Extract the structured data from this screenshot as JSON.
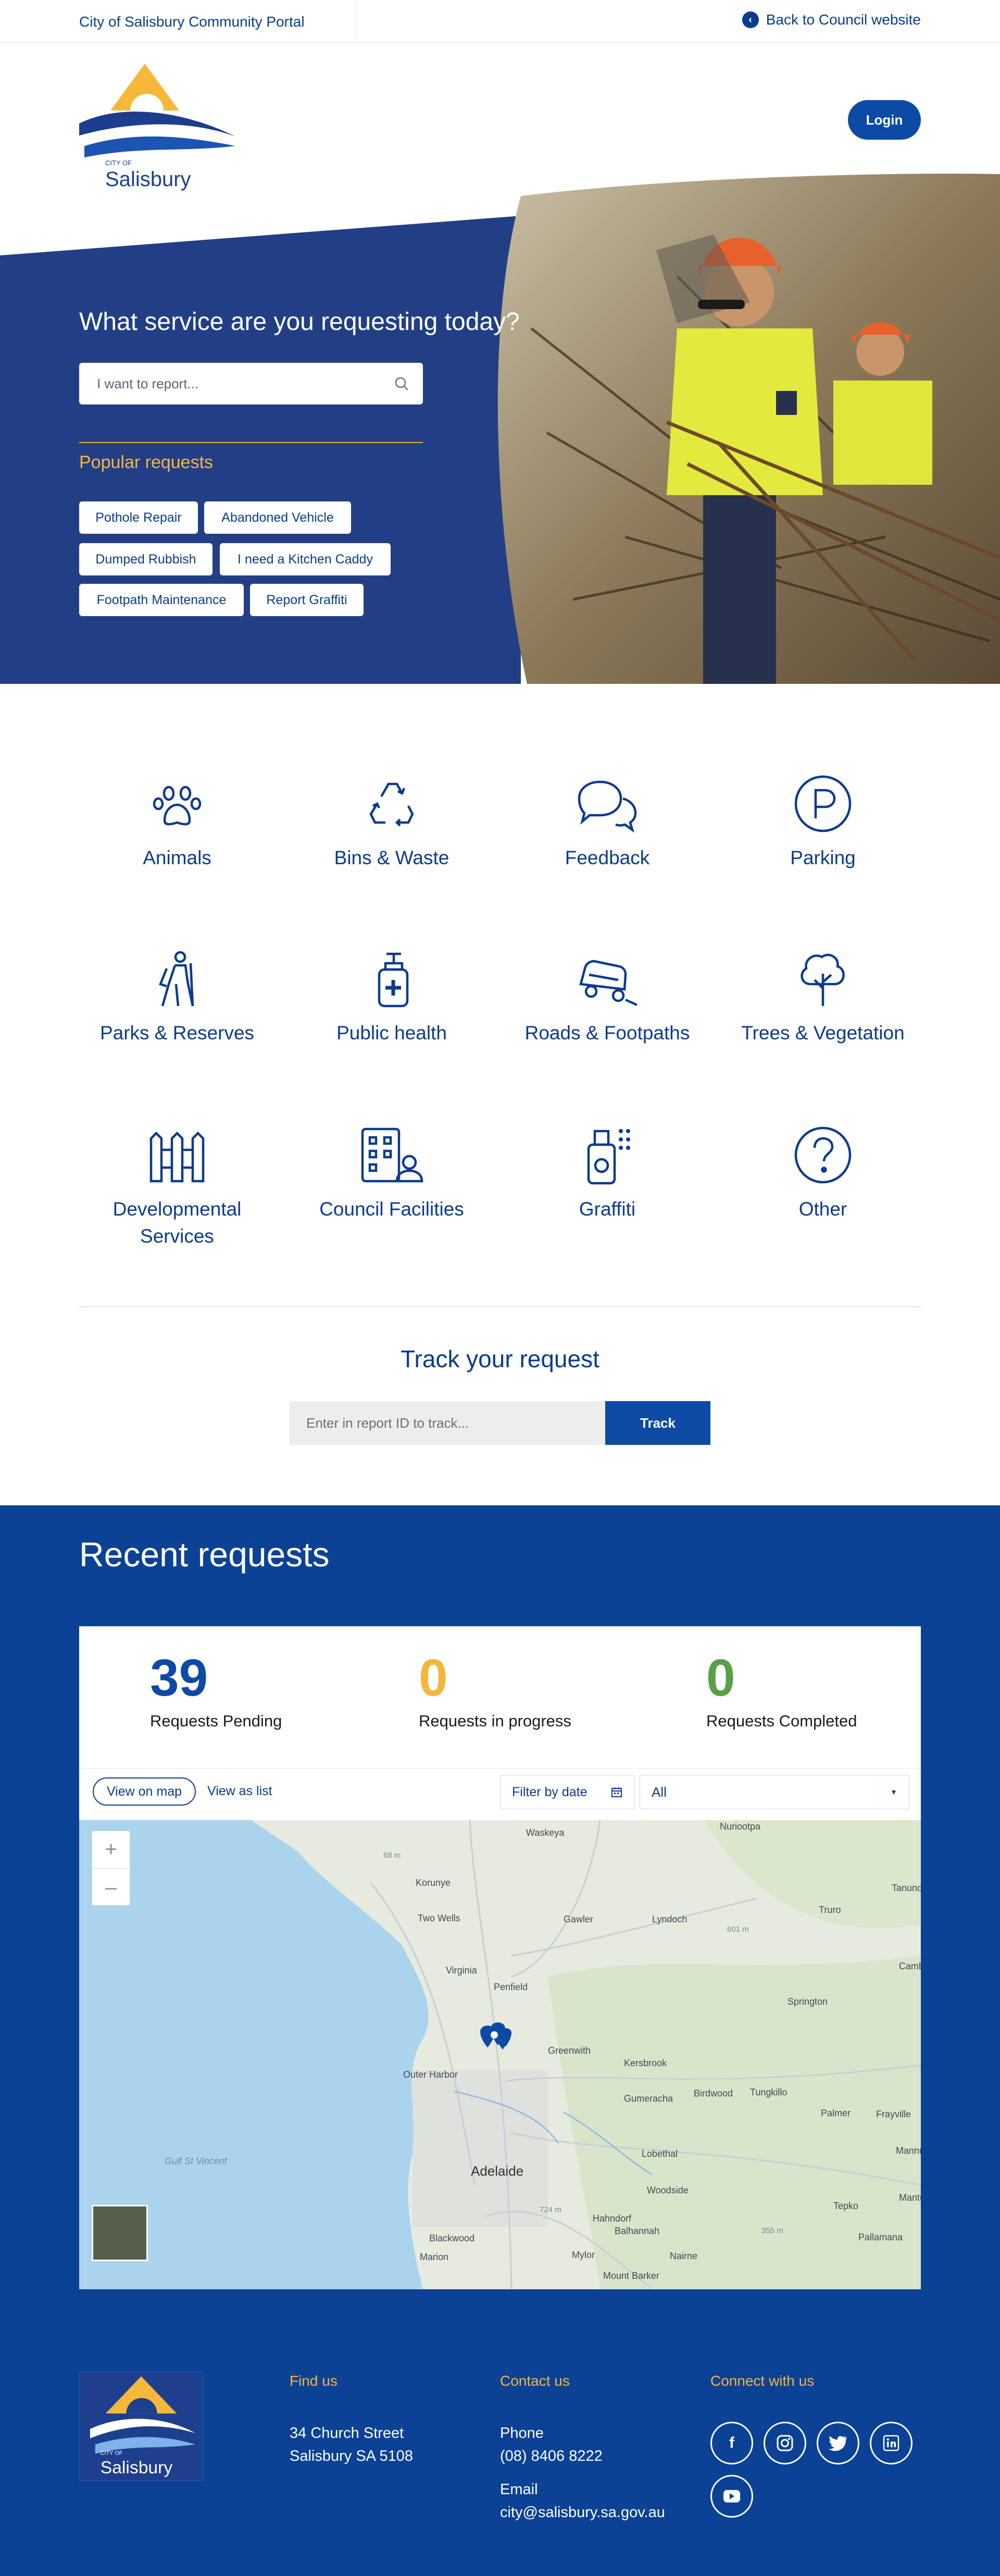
{
  "topbar": {
    "portal": "City of Salisbury Community Portal",
    "back": "Back to Council website"
  },
  "brand": {
    "city_of": "CITY OF",
    "name": "Salisbury"
  },
  "header": {
    "login": "Login"
  },
  "hero": {
    "title": "What service are you requesting today?",
    "search_placeholder": "I want to report...",
    "popular_title": "Popular requests",
    "popular": [
      "Pothole Repair",
      "Abandoned Vehicle",
      "Dumped Rubbish",
      "I need a Kitchen Caddy",
      "Footpath Maintenance",
      "Report Graffiti"
    ]
  },
  "categories": [
    {
      "label": "Animals",
      "icon": "paw-icon"
    },
    {
      "label": "Bins & Waste",
      "icon": "recycle-icon"
    },
    {
      "label": "Feedback",
      "icon": "chat-bubbles-icon"
    },
    {
      "label": "Parking",
      "icon": "parking-icon"
    },
    {
      "label": "Parks & Reserves",
      "icon": "hiker-icon"
    },
    {
      "label": "Public health",
      "icon": "sanitizer-icon"
    },
    {
      "label": "Roads & Footpaths",
      "icon": "car-accident-icon"
    },
    {
      "label": "Trees & Vegetation",
      "icon": "tree-icon"
    },
    {
      "label": "Developmental Services",
      "icon": "fence-icon"
    },
    {
      "label": "Council Facilities",
      "icon": "building-person-icon"
    },
    {
      "label": "Graffiti",
      "icon": "spray-can-icon"
    },
    {
      "label": "Other",
      "icon": "question-icon"
    }
  ],
  "track": {
    "title": "Track your request",
    "placeholder": "Enter in report ID to track...",
    "button": "Track"
  },
  "recent": {
    "title": "Recent requests",
    "stats": [
      {
        "value": "39",
        "label": "Requests Pending",
        "color": "#0c4aa6"
      },
      {
        "value": "0",
        "label": "Requests in progress",
        "color": "#f3b73c"
      },
      {
        "value": "0",
        "label": "Requests Completed",
        "color": "#5aa046"
      }
    ],
    "view_map": "View on map",
    "view_list": "View as list",
    "filter_label": "Filter by date",
    "select_value": "All",
    "map_labels": [
      "Waskeya",
      "Nuriootpa",
      "Korunye",
      "Two Wells",
      "Gawler",
      "Lyndoch",
      "Tanunda",
      "Virginia",
      "Penfield",
      "Springton",
      "Greenwith",
      "Kersbrook",
      "Outer Harbor",
      "Gumeracha",
      "Birdwood",
      "Tungkillo",
      "Palmer",
      "Adelaide",
      "Lobethal",
      "Woodside",
      "Hahndorf",
      "Balhannah",
      "Mylor",
      "Nairne",
      "Mount Barker",
      "Blackwood",
      "Marion",
      "Gulf St Vincent",
      "Pallamana",
      "Tepko",
      "Frayville",
      "Mannum",
      "Cambrai",
      "Truro",
      "Mantung",
      "68 m",
      "601 m",
      "724 m",
      "355 m"
    ]
  },
  "footer": {
    "find_us": "Find us",
    "address": [
      "34 Church Street",
      "Salisbury SA 5108"
    ],
    "contact_us": "Contact us",
    "phone_label": "Phone",
    "phone": "(08) 8406 8222",
    "email_label": "Email",
    "email": "city@salisbury.sa.gov.au",
    "connect": "Connect with us",
    "social": [
      "facebook-icon",
      "instagram-icon",
      "twitter-icon",
      "linkedin-icon",
      "youtube-icon"
    ]
  },
  "colors": {
    "primary": "#0b3b8c",
    "accent": "#f3b73c",
    "button": "#0c4aa6",
    "footer_bg": "#0b4296",
    "green": "#5aa046"
  }
}
